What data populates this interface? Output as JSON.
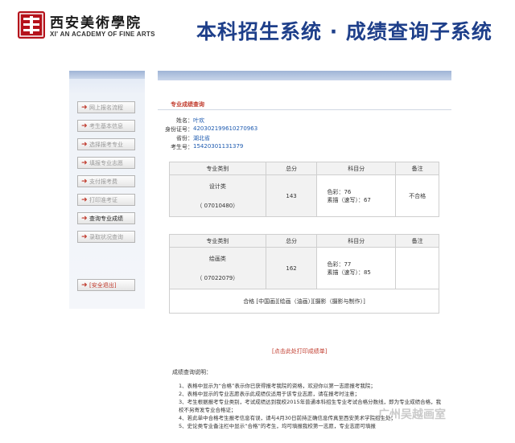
{
  "header": {
    "logo_cn": "西安美術學院",
    "logo_en": "XI' AN ACADEMY OF FINE ARTS",
    "system_title": "本科招生系统 · 成绩查询子系统"
  },
  "sidebar": {
    "items": [
      {
        "label": "网上报名流程",
        "active": false
      },
      {
        "label": "考生基本信息",
        "active": false
      },
      {
        "label": "选择报考专业",
        "active": false
      },
      {
        "label": "填报专业志愿",
        "active": false
      },
      {
        "label": "支付报考费",
        "active": false
      },
      {
        "label": "打印准考证",
        "active": false
      },
      {
        "label": "查询专业成绩",
        "active": true
      },
      {
        "label": "录取状况查询",
        "active": false
      }
    ],
    "logout_label": "[安全退出]"
  },
  "main": {
    "section_title": "专业成绩查询",
    "info": [
      {
        "key": "姓名：",
        "value": "叶欢"
      },
      {
        "key": "身份证号：",
        "value": "420302199610270963"
      },
      {
        "key": "省份：",
        "value": "湖北省"
      },
      {
        "key": "考生号：",
        "value": "15420301131379"
      }
    ],
    "headers": [
      "专业类别",
      "总分",
      "科目分",
      "备注"
    ],
    "results": [
      {
        "category": "设计类",
        "code": "（ 07010480）",
        "total": "143",
        "subject1": "色彩：76",
        "subject2": "素描（速写）：67",
        "remark": "不合格"
      },
      {
        "category": "绘画类",
        "code": "（ 07022079）",
        "total": "162",
        "subject1": "色彩：77",
        "subject2": "素描（速写）：85",
        "remark": ""
      }
    ],
    "qualified_note": "合格 [中国画][绘画（油画）][摄影（摄影与制作）]",
    "print_link": "[点击此处打印成绩单]",
    "explain_title": "成绩查询说明：",
    "explain_items": [
      "1、表格中显示为“合格”表示你已获得报考我院的资格，欢迎你以第一志愿报考我院；",
      "2、表格中显示的专业志愿表示此成绩仅适用于该专业志愿，请在报考时注意；",
      "3、考生根据报考专业类别，考试成绩达到我校2015年普通本科招生专业考试合格分数线，即为专业成绩合格，我校不另寄发专业合格证；",
      "4、若此单中合格考生报考信息有误，请与4月30日前持正确信息传真至西安美术学院招生处；",
      "5、史论类专业备注栏中显示“合格”的考生，均可填报我校第一志愿，专业志愿可填报"
    ],
    "watermark": "广州吴越画室"
  },
  "colors": {
    "title_blue": "#1e3f8a",
    "accent_red": "#c0392b",
    "value_blue": "#1e5bb0"
  }
}
